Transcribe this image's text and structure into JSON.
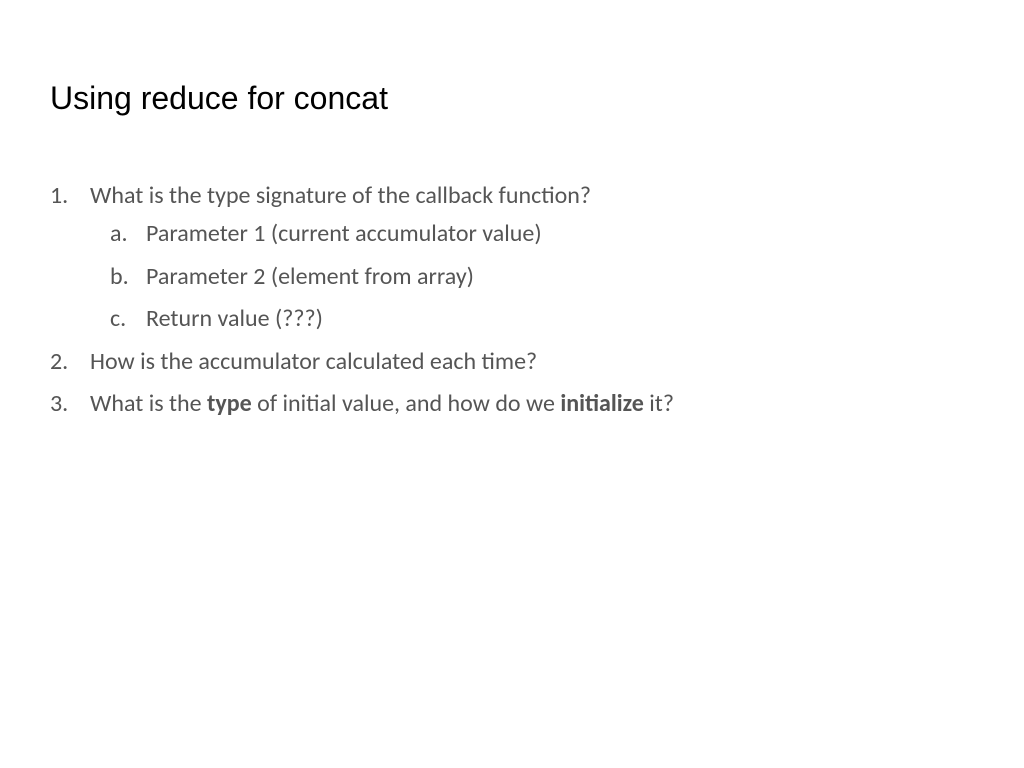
{
  "title": "Using reduce for concat",
  "items": {
    "q1": {
      "text": "What is the type signature of the callback function?",
      "sub": {
        "a": "Parameter 1 (current accumulator value)",
        "b": "Parameter 2 (element from array)",
        "c": "Return value (???)"
      }
    },
    "q2": {
      "text": "How is the accumulator calculated each time?"
    },
    "q3": {
      "prefix": "What is the ",
      "bold1": "type",
      "mid": " of initial value, and how do we ",
      "bold2": "initialize",
      "suffix": " it?"
    }
  }
}
